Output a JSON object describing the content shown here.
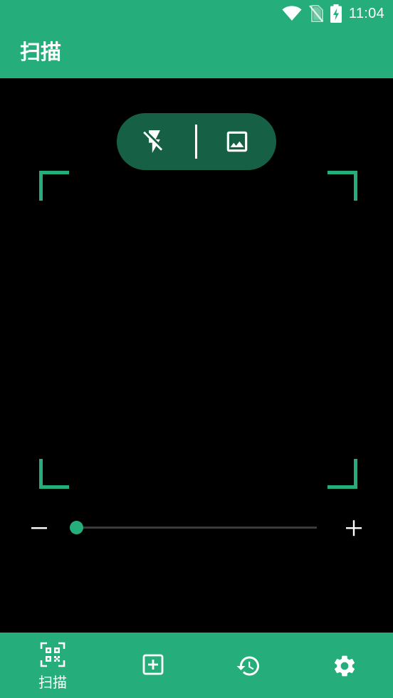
{
  "status_bar": {
    "time": "11:04",
    "icons": [
      "wifi-icon",
      "no-sim-icon",
      "battery-charging-icon"
    ]
  },
  "app_bar": {
    "title": "扫描"
  },
  "scanner": {
    "toolbar": {
      "flash_icon": "flash-off-icon",
      "gallery_icon": "image-icon"
    },
    "zoom": {
      "level": 0,
      "minus_icon": "minus-icon",
      "plus_icon": "plus-icon"
    }
  },
  "bottom_nav": {
    "items": [
      {
        "icon": "qr-scan-icon",
        "label": "扫描",
        "active": true
      },
      {
        "icon": "add-box-icon",
        "label": "",
        "active": false
      },
      {
        "icon": "history-icon",
        "label": "",
        "active": false
      },
      {
        "icon": "settings-gear-icon",
        "label": "",
        "active": false
      }
    ]
  },
  "colors": {
    "primary": "#25ad7c",
    "pill_background": "#166146",
    "camera_background": "#000000",
    "track": "#3a3a3a",
    "on_primary": "#ffffff"
  }
}
